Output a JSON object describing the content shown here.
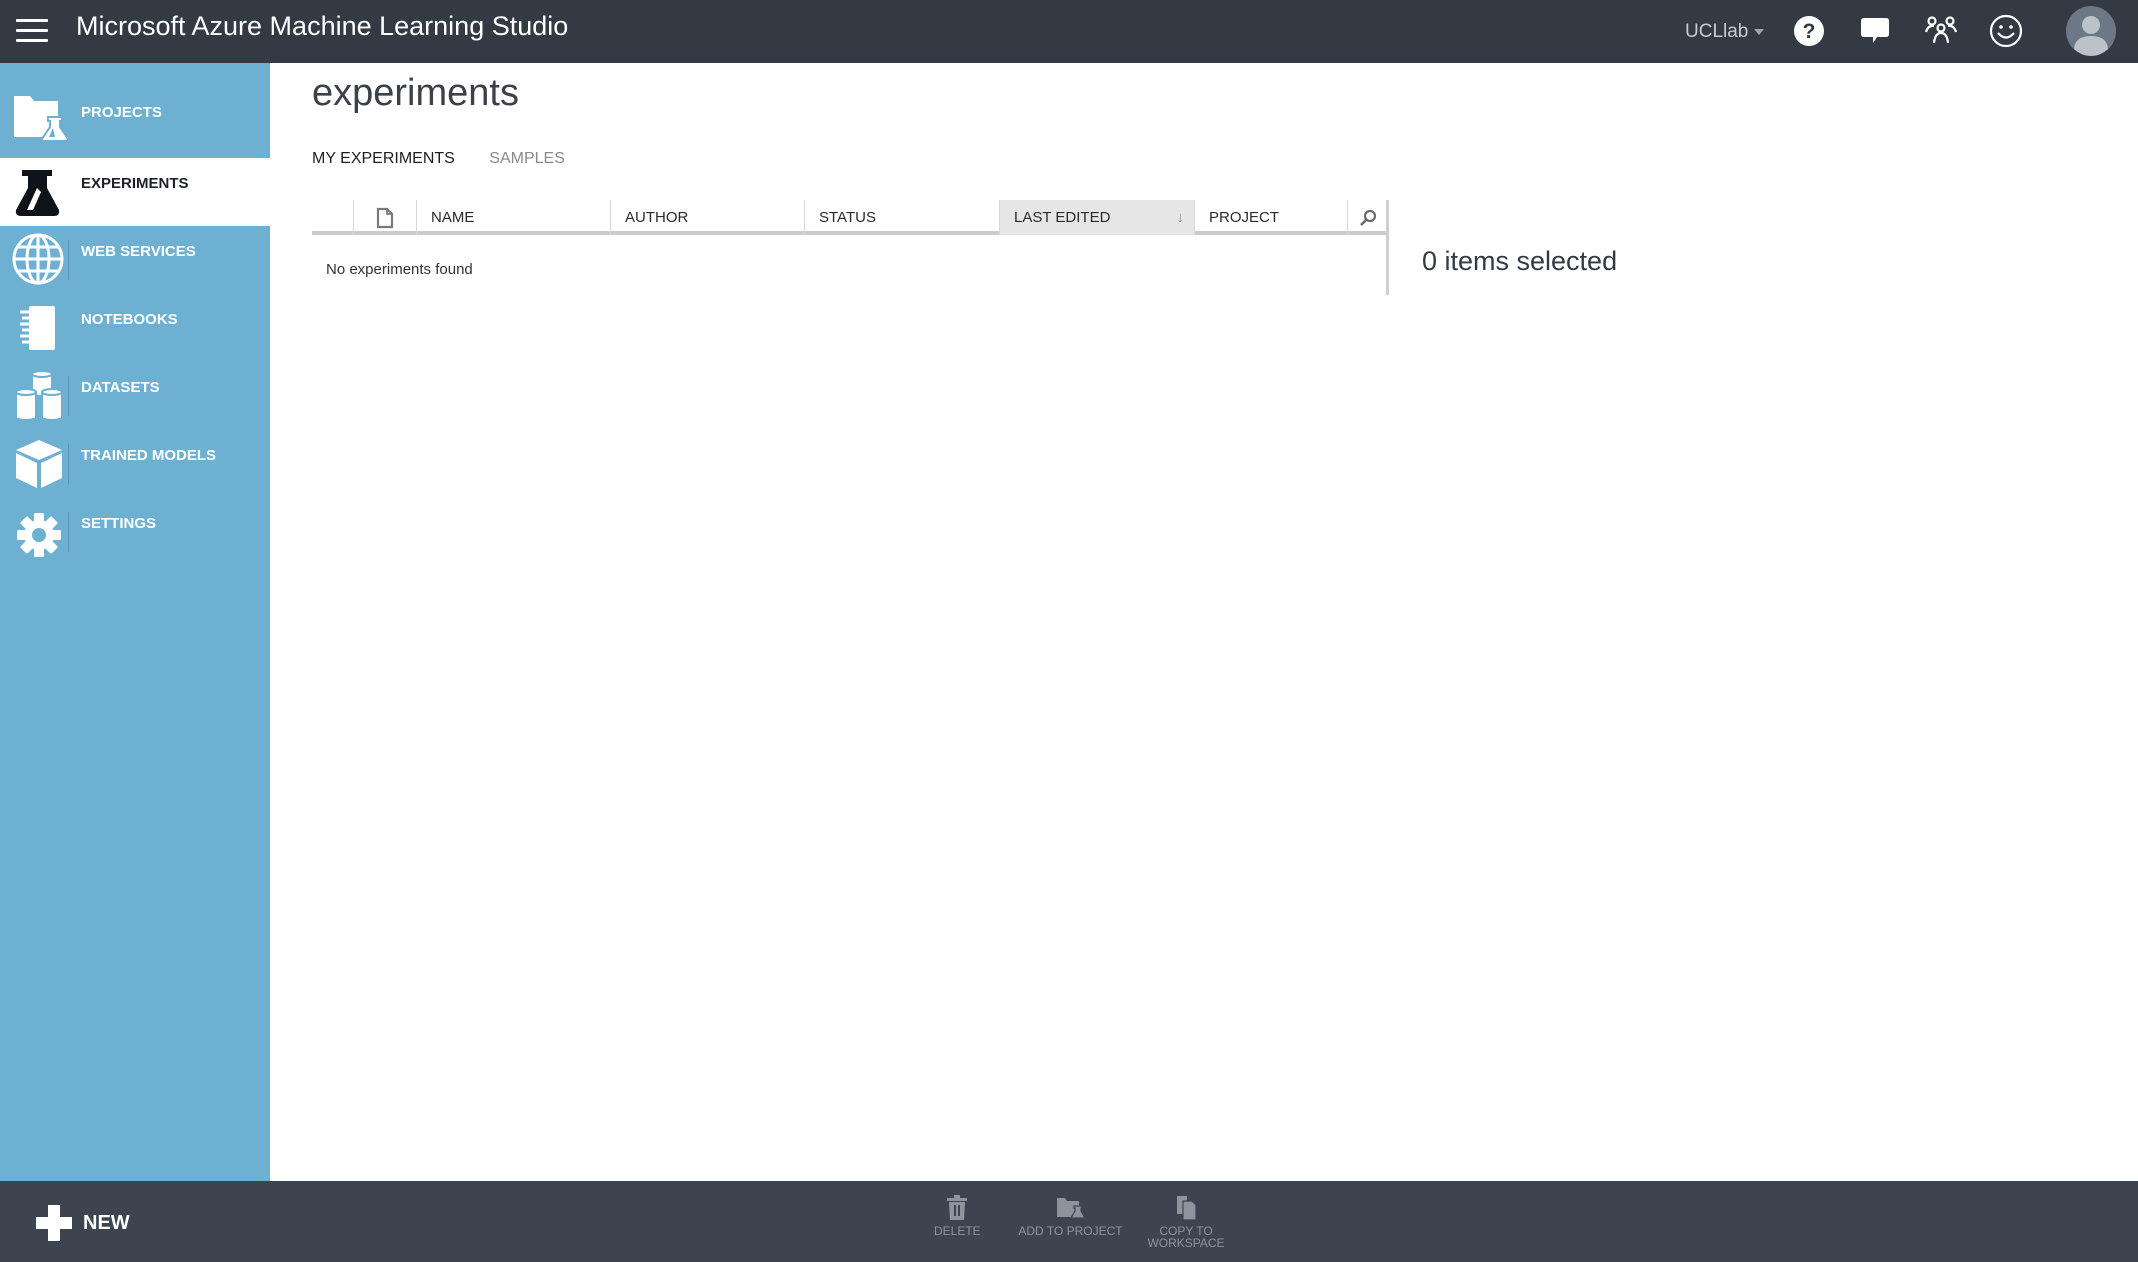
{
  "topbar": {
    "app_title": "Microsoft Azure Machine Learning Studio",
    "workspace": "UCLlab",
    "icons": [
      "menu-icon",
      "help-icon",
      "feedback-icon",
      "community-icon",
      "smiley-icon",
      "user-avatar-icon"
    ]
  },
  "sidebar": {
    "items": [
      {
        "label": "PROJECTS",
        "icon": "projects-icon",
        "active": false
      },
      {
        "label": "EXPERIMENTS",
        "icon": "flask-icon",
        "active": true
      },
      {
        "label": "WEB SERVICES",
        "icon": "globe-icon",
        "active": false
      },
      {
        "label": "NOTEBOOKS",
        "icon": "notebook-icon",
        "active": false
      },
      {
        "label": "DATASETS",
        "icon": "datasets-icon",
        "active": false
      },
      {
        "label": "TRAINED MODELS",
        "icon": "cube-icon",
        "active": false
      },
      {
        "label": "SETTINGS",
        "icon": "gear-icon",
        "active": false
      }
    ]
  },
  "main": {
    "title": "experiments",
    "tabs": [
      {
        "label": "MY EXPERIMENTS",
        "active": true
      },
      {
        "label": "SAMPLES",
        "active": false
      }
    ],
    "table": {
      "columns": [
        "NAME",
        "AUTHOR",
        "STATUS",
        "LAST EDITED",
        "PROJECT"
      ],
      "sorted_column": "LAST EDITED",
      "sort_direction": "descending",
      "empty_message": "No experiments found",
      "rows": []
    },
    "selection_summary": "0 items selected"
  },
  "bottombar": {
    "new_label": "NEW",
    "actions": [
      {
        "label": "DELETE",
        "icon": "trash-icon"
      },
      {
        "label": "ADD TO PROJECT",
        "icon": "add-to-project-icon"
      },
      {
        "label_line1": "COPY TO",
        "label_line2": "WORKSPACE",
        "icon": "copy-icon"
      }
    ]
  },
  "colors": {
    "topbar_bg": "#333a44",
    "sidebar_bg": "#6db0d2",
    "bottombar_bg": "#3c4450",
    "sorted_header_bg": "#e6e6e6"
  }
}
